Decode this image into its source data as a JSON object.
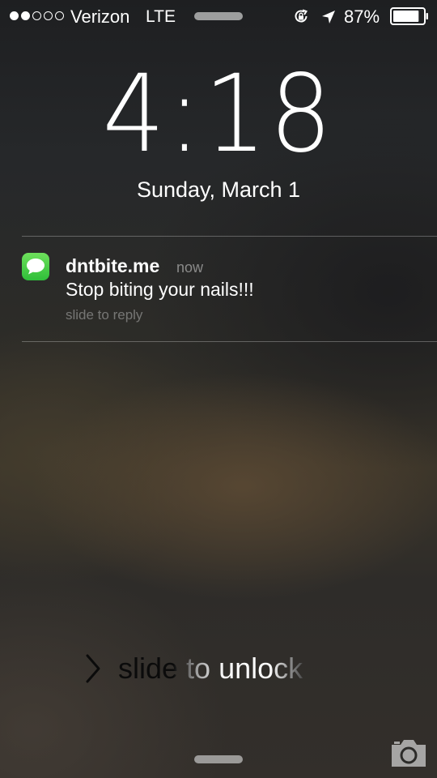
{
  "status_bar": {
    "signal_bars_filled": 2,
    "signal_bars_total": 5,
    "carrier": "Verizon",
    "network": "LTE",
    "battery_percent": "87%",
    "battery_level": 0.87,
    "icons": [
      "rotation-lock-icon",
      "location-arrow-icon",
      "battery-icon"
    ]
  },
  "lock_screen": {
    "time": "4:18",
    "date": "Sunday, March 1"
  },
  "notification": {
    "app_icon": "messages-icon",
    "sender": "dntbite.me",
    "time": "now",
    "message": "Stop biting your nails!!!",
    "hint": "slide to reply"
  },
  "unlock": {
    "label": "slide to unlock",
    "icon": "chevron-right-icon"
  },
  "bottom": {
    "icons": [
      "home-grabber",
      "camera-icon"
    ]
  },
  "colors": {
    "messages_green": "#4cd964",
    "text": "#ffffff"
  }
}
